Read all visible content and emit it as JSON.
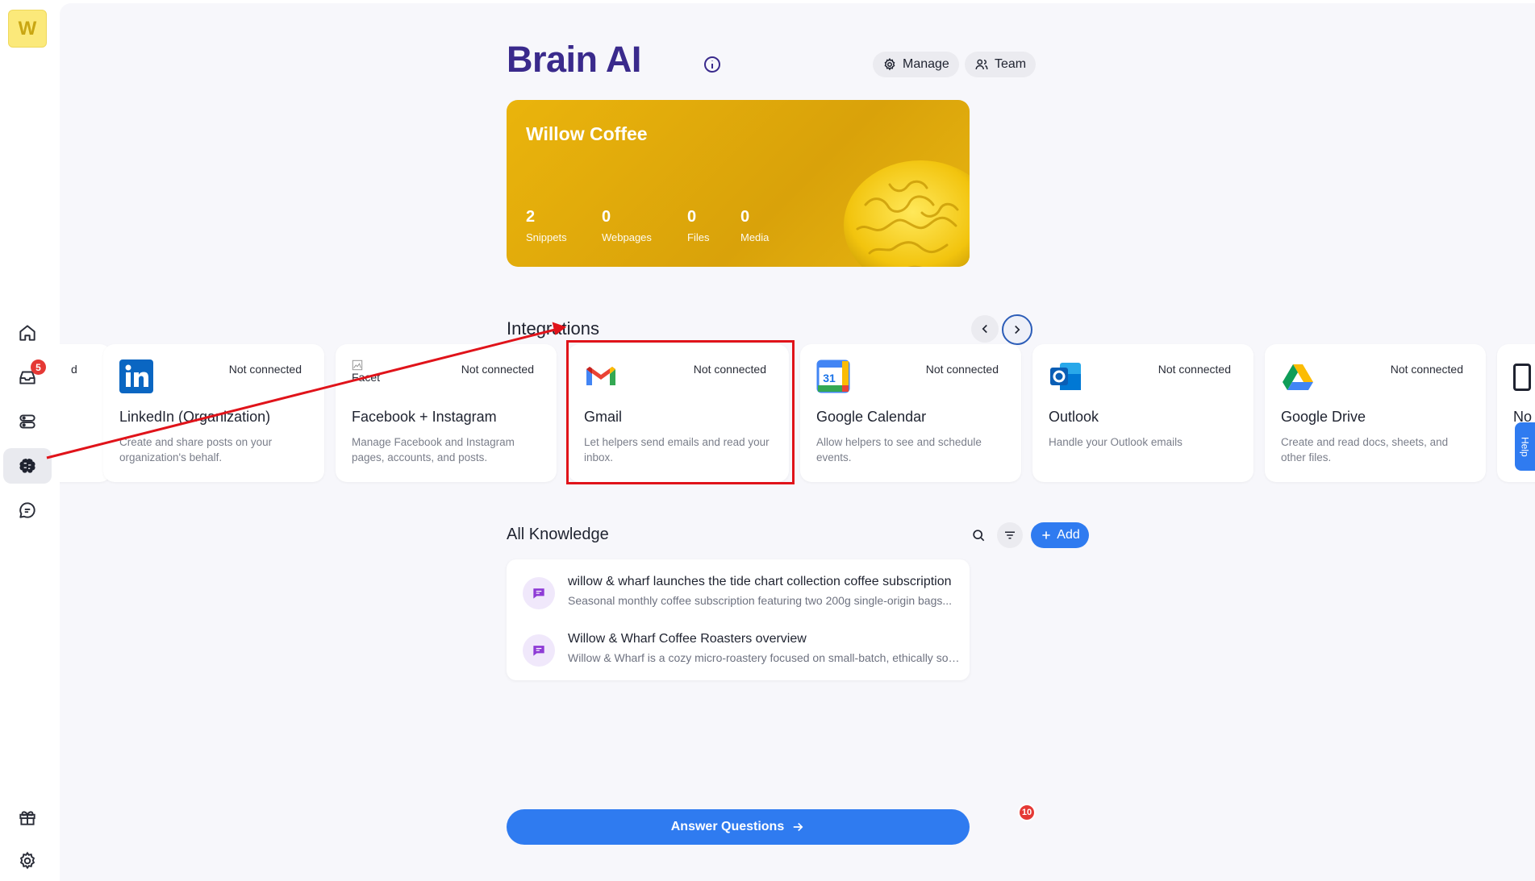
{
  "sidebar": {
    "logo_letter": "W",
    "notifications_count": "5",
    "items": [
      {
        "name": "home-icon"
      },
      {
        "name": "inbox-icon"
      },
      {
        "name": "helpers-icon"
      },
      {
        "name": "brain-icon"
      },
      {
        "name": "chat-icon"
      },
      {
        "name": "gift-icon"
      },
      {
        "name": "settings-icon"
      }
    ]
  },
  "header": {
    "title": "Brain AI",
    "manage_label": "Manage",
    "team_label": "Team"
  },
  "hero": {
    "business_name": "Willow Coffee",
    "stats": [
      {
        "value": "2",
        "label": "Snippets"
      },
      {
        "value": "0",
        "label": "Webpages"
      },
      {
        "value": "0",
        "label": "Files"
      },
      {
        "value": "0",
        "label": "Media"
      }
    ]
  },
  "integrations": {
    "title": "Integrations",
    "partial_left_fragment": "d",
    "partial_right_fragment": "No",
    "cards": [
      {
        "name": "LinkedIn (Organization)",
        "status": "Not connected",
        "desc": "Create and share posts on your organization's behalf.",
        "icon": "linkedin-icon"
      },
      {
        "name": "Facebook + Instagram",
        "status": "Not connected",
        "desc": "Manage Facebook and Instagram pages, accounts, and posts.",
        "icon": "facebook-icon",
        "broken_alt": "Facet"
      },
      {
        "name": "Gmail",
        "status": "Not connected",
        "desc": "Let helpers send emails and read your inbox.",
        "icon": "gmail-icon"
      },
      {
        "name": "Google Calendar",
        "status": "Not connected",
        "desc": "Allow helpers to see and schedule events.",
        "icon": "google-calendar-icon",
        "icon_text": "31"
      },
      {
        "name": "Outlook",
        "status": "Not connected",
        "desc": "Handle your Outlook emails",
        "icon": "outlook-icon"
      },
      {
        "name": "Google Drive",
        "status": "Not connected",
        "desc": "Create and read docs, sheets, and other files.",
        "icon": "google-drive-icon"
      }
    ]
  },
  "knowledge": {
    "title": "All Knowledge",
    "add_label": "Add",
    "items": [
      {
        "title": "willow & wharf launches the tide chart collection coffee subscription",
        "snippet": "Seasonal monthly coffee subscription featuring two 200g single-origin bags..."
      },
      {
        "title": "Willow & Wharf Coffee Roasters overview",
        "snippet": "Willow & Wharf is a cozy micro-roastery focused on small-batch, ethically sou..."
      }
    ]
  },
  "footer": {
    "answer_label": "Answer Questions",
    "answer_badge": "10",
    "help_label": "Help"
  },
  "colors": {
    "brand_title": "#3a2a8c",
    "primary_blue": "#2f7bf0",
    "hero_yellow": "#e3ad0c",
    "highlight_red": "#e0131a"
  }
}
